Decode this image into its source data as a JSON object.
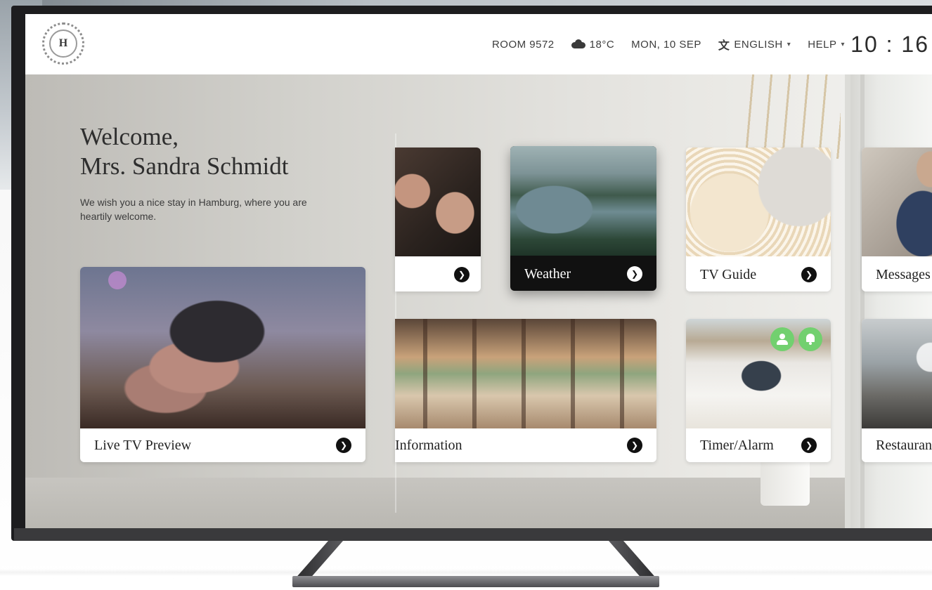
{
  "topbar": {
    "logo_letter": "H",
    "room": "ROOM 9572",
    "weather": "18°C",
    "weather_icon": "cloud-sun-icon",
    "date": "MON, 10 SEP",
    "language": "ENGLISH",
    "language_icon": "translate-icon",
    "help": "HELP",
    "clock": "10 : 16"
  },
  "welcome": {
    "title_line1": "Welcome,",
    "title_line2": "Mrs. Sandra Schmidt",
    "message": "We wish you a nice stay in Hamburg, where you are heartily welcome."
  },
  "tiles": {
    "live_tv": "Live TV Preview",
    "weather": "Weather",
    "tv_guide": "TV Guide",
    "messages": "Messages",
    "information": "Information",
    "timer_alarm": "Timer/Alarm",
    "restaurant": "Restauran"
  },
  "colors": {
    "badge_green": "#72d06f",
    "selected_tile": "#111111"
  }
}
